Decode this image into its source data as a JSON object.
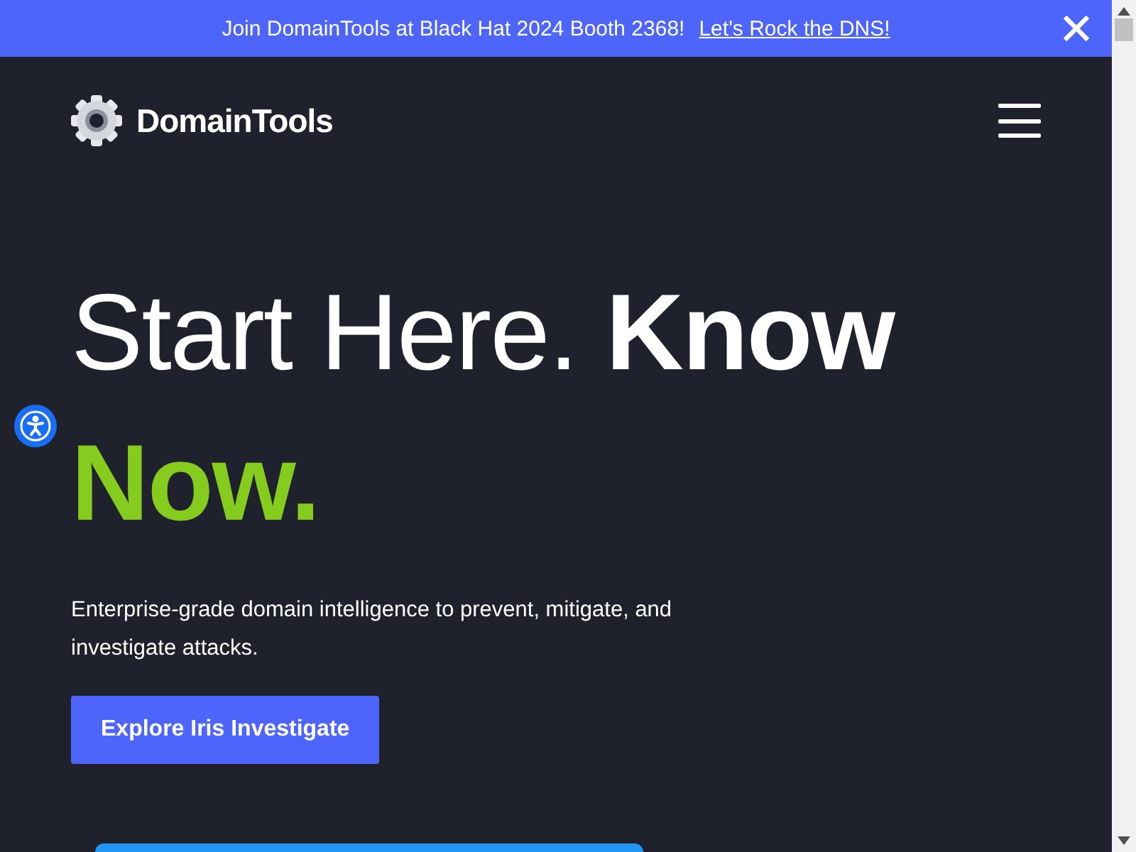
{
  "banner": {
    "message": "Join DomainTools at Black Hat 2024 Booth 2368!",
    "link": "Let's Rock the DNS!"
  },
  "nav": {
    "brand": "DomainTools"
  },
  "hero": {
    "headline": [
      {
        "text": "Start Here.",
        "kind": "light"
      },
      {
        "text": "Know",
        "kind": "bold"
      },
      {
        "text": "Now.",
        "kind": "accent"
      }
    ],
    "description": "Enterprise-grade domain intelligence to prevent, mitigate, and investigate attacks.",
    "cta": "Explore Iris Investigate"
  }
}
